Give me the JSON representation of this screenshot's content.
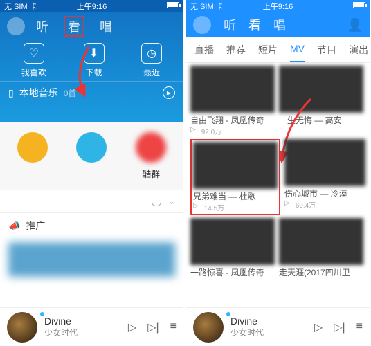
{
  "status": {
    "carrier": "无 SIM 卡",
    "time": "上午9:16"
  },
  "left": {
    "tabs": {
      "listen": "听",
      "watch": "看",
      "sing": "唱"
    },
    "quick": {
      "fav": "我喜欢",
      "download": "下载",
      "recent": "最近"
    },
    "local": {
      "label": "本地音乐",
      "count": "0首"
    },
    "circles": {
      "c3": "酷群"
    },
    "rows": {
      "tuiguang": "推广"
    },
    "playing": {
      "title": "Divine",
      "artist": "少女时代"
    }
  },
  "right": {
    "tabs": {
      "listen": "听",
      "watch": "看",
      "sing": "唱"
    },
    "subtabs": [
      "直播",
      "推荐",
      "短片",
      "MV",
      "节目",
      "演出"
    ],
    "mv": [
      {
        "title": "自由飞翔 - 凤凰传奇",
        "plays": "92.0万"
      },
      {
        "title": "一生无悔 — 高安",
        "plays": ""
      },
      {
        "title": "兄弟难当 — 杜歌",
        "plays": "14.5万"
      },
      {
        "title": "伤心城市 — 冷漠",
        "plays": "69.4万"
      },
      {
        "title": "一路惊喜 - 凤凰传奇",
        "plays": ""
      },
      {
        "title": "走天涯(2017四川卫",
        "plays": ""
      }
    ],
    "playing": {
      "title": "Divine",
      "artist": "少女时代"
    }
  }
}
